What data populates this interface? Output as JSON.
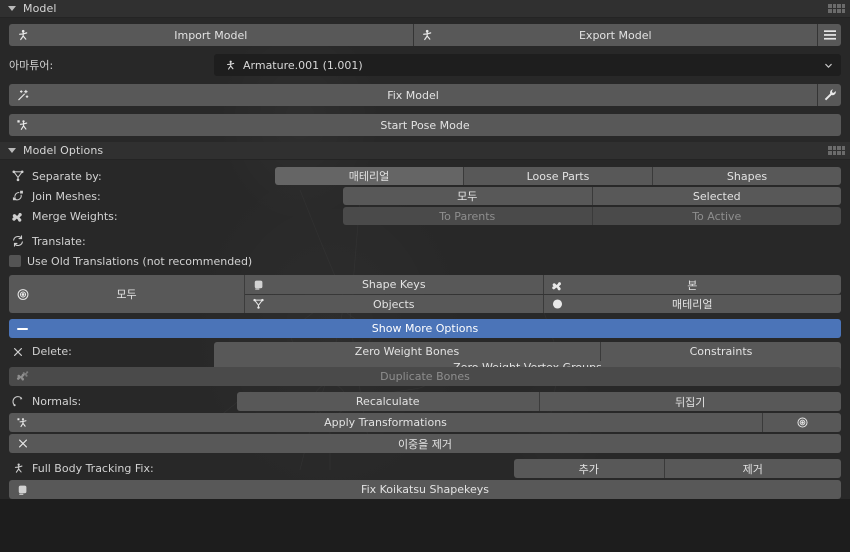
{
  "panels": {
    "model": {
      "title": "Model"
    },
    "model_options": {
      "title": "Model Options"
    }
  },
  "model": {
    "import_button": "Import Model",
    "export_button": "Export Model",
    "menu_icon": "hamburger-icon",
    "armature_label": "아마튜어:",
    "armature_value": "Armature.001 (1.001)",
    "fix_model_button": "Fix Model",
    "fix_model_settings_icon": "wrench-icon",
    "start_pose_mode_button": "Start Pose Mode"
  },
  "model_options": {
    "separate_by": {
      "label": "Separate by:",
      "icon": "mesh-vertex-icon",
      "options": [
        "매테리얼",
        "Loose Parts",
        "Shapes"
      ],
      "hovered": "매테리얼"
    },
    "join_meshes": {
      "label": "Join Meshes:",
      "icon": "join-icon",
      "options": [
        "모두",
        "Selected"
      ]
    },
    "merge_weights": {
      "label": "Merge Weights:",
      "icon": "bone-icon",
      "options": [
        "To Parents",
        "To Active"
      ],
      "disabled": true
    },
    "translate": {
      "label": "Translate:",
      "icon": "refresh-icon",
      "checkbox_label": "Use Old Translations (not recommended)",
      "checkbox_checked": false,
      "all_button": {
        "label": "모두",
        "icon": "target-icon"
      },
      "buttons": [
        {
          "label": "Shape Keys",
          "icon": "shapekey-icon"
        },
        {
          "label": "본",
          "icon": "bone-icon"
        },
        {
          "label": "Objects",
          "icon": "mesh-vertex-icon"
        },
        {
          "label": "매테리얼",
          "icon": "material-sphere-icon"
        }
      ]
    },
    "show_more_options": "Show More Options",
    "delete": {
      "label": "Delete:",
      "icon": "x-icon",
      "options": [
        "Zero Weight Bones",
        "Constraints",
        "Zero Weight Vertex Groups"
      ]
    },
    "duplicate_bones": {
      "label": "Duplicate Bones",
      "icon": "bones-icon",
      "disabled": true
    },
    "normals": {
      "label": "Normals:",
      "icon": "normals-icon",
      "options": [
        "Recalculate",
        "뒤집기"
      ]
    },
    "apply_transformations": {
      "label": "Apply Transformations",
      "icon": "armature-icon",
      "settings_icon": "target-icon"
    },
    "remove_doubles": {
      "label": "이중을 제거",
      "icon": "x-icon"
    },
    "full_body_tracking_fix": {
      "label": "Full Body Tracking Fix:",
      "icon": "armature-icon",
      "options": [
        "추가",
        "제거"
      ]
    },
    "fix_koikatsu_shapekeys": {
      "label": "Fix Koikatsu Shapekeys",
      "icon": "shapekey-icon"
    }
  },
  "colors": {
    "accent_blue": "#4b74b8",
    "panel_bg": "#282828",
    "header_bg": "#303030",
    "button_bg": "#585858",
    "button_dark": "#4d4d4d",
    "window_bg": "#1d1d1d"
  }
}
